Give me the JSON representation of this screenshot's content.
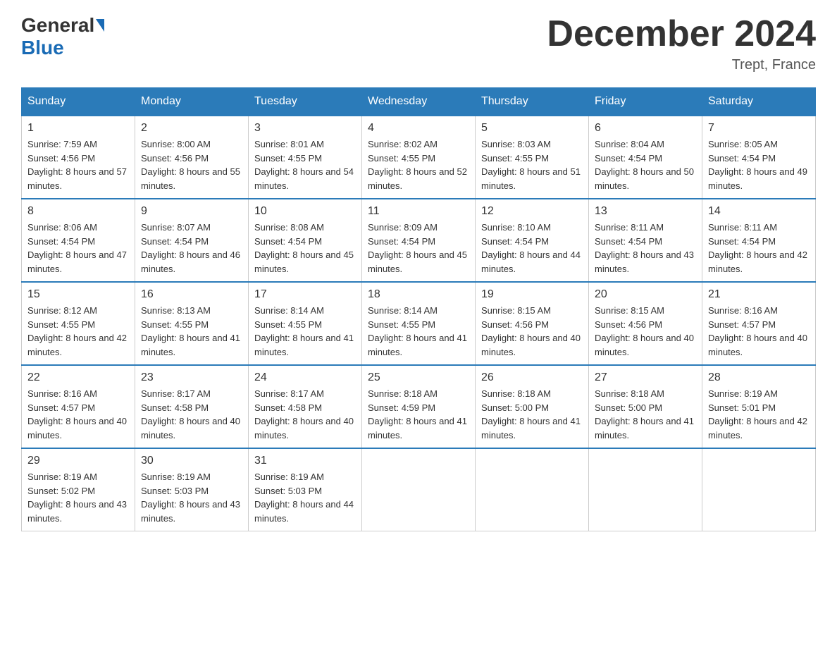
{
  "header": {
    "logo_general": "General",
    "logo_blue": "Blue",
    "month_title": "December 2024",
    "location": "Trept, France"
  },
  "days_of_week": [
    "Sunday",
    "Monday",
    "Tuesday",
    "Wednesday",
    "Thursday",
    "Friday",
    "Saturday"
  ],
  "weeks": [
    [
      {
        "day": "1",
        "sunrise": "7:59 AM",
        "sunset": "4:56 PM",
        "daylight": "8 hours and 57 minutes."
      },
      {
        "day": "2",
        "sunrise": "8:00 AM",
        "sunset": "4:56 PM",
        "daylight": "8 hours and 55 minutes."
      },
      {
        "day": "3",
        "sunrise": "8:01 AM",
        "sunset": "4:55 PM",
        "daylight": "8 hours and 54 minutes."
      },
      {
        "day": "4",
        "sunrise": "8:02 AM",
        "sunset": "4:55 PM",
        "daylight": "8 hours and 52 minutes."
      },
      {
        "day": "5",
        "sunrise": "8:03 AM",
        "sunset": "4:55 PM",
        "daylight": "8 hours and 51 minutes."
      },
      {
        "day": "6",
        "sunrise": "8:04 AM",
        "sunset": "4:54 PM",
        "daylight": "8 hours and 50 minutes."
      },
      {
        "day": "7",
        "sunrise": "8:05 AM",
        "sunset": "4:54 PM",
        "daylight": "8 hours and 49 minutes."
      }
    ],
    [
      {
        "day": "8",
        "sunrise": "8:06 AM",
        "sunset": "4:54 PM",
        "daylight": "8 hours and 47 minutes."
      },
      {
        "day": "9",
        "sunrise": "8:07 AM",
        "sunset": "4:54 PM",
        "daylight": "8 hours and 46 minutes."
      },
      {
        "day": "10",
        "sunrise": "8:08 AM",
        "sunset": "4:54 PM",
        "daylight": "8 hours and 45 minutes."
      },
      {
        "day": "11",
        "sunrise": "8:09 AM",
        "sunset": "4:54 PM",
        "daylight": "8 hours and 45 minutes."
      },
      {
        "day": "12",
        "sunrise": "8:10 AM",
        "sunset": "4:54 PM",
        "daylight": "8 hours and 44 minutes."
      },
      {
        "day": "13",
        "sunrise": "8:11 AM",
        "sunset": "4:54 PM",
        "daylight": "8 hours and 43 minutes."
      },
      {
        "day": "14",
        "sunrise": "8:11 AM",
        "sunset": "4:54 PM",
        "daylight": "8 hours and 42 minutes."
      }
    ],
    [
      {
        "day": "15",
        "sunrise": "8:12 AM",
        "sunset": "4:55 PM",
        "daylight": "8 hours and 42 minutes."
      },
      {
        "day": "16",
        "sunrise": "8:13 AM",
        "sunset": "4:55 PM",
        "daylight": "8 hours and 41 minutes."
      },
      {
        "day": "17",
        "sunrise": "8:14 AM",
        "sunset": "4:55 PM",
        "daylight": "8 hours and 41 minutes."
      },
      {
        "day": "18",
        "sunrise": "8:14 AM",
        "sunset": "4:55 PM",
        "daylight": "8 hours and 41 minutes."
      },
      {
        "day": "19",
        "sunrise": "8:15 AM",
        "sunset": "4:56 PM",
        "daylight": "8 hours and 40 minutes."
      },
      {
        "day": "20",
        "sunrise": "8:15 AM",
        "sunset": "4:56 PM",
        "daylight": "8 hours and 40 minutes."
      },
      {
        "day": "21",
        "sunrise": "8:16 AM",
        "sunset": "4:57 PM",
        "daylight": "8 hours and 40 minutes."
      }
    ],
    [
      {
        "day": "22",
        "sunrise": "8:16 AM",
        "sunset": "4:57 PM",
        "daylight": "8 hours and 40 minutes."
      },
      {
        "day": "23",
        "sunrise": "8:17 AM",
        "sunset": "4:58 PM",
        "daylight": "8 hours and 40 minutes."
      },
      {
        "day": "24",
        "sunrise": "8:17 AM",
        "sunset": "4:58 PM",
        "daylight": "8 hours and 40 minutes."
      },
      {
        "day": "25",
        "sunrise": "8:18 AM",
        "sunset": "4:59 PM",
        "daylight": "8 hours and 41 minutes."
      },
      {
        "day": "26",
        "sunrise": "8:18 AM",
        "sunset": "5:00 PM",
        "daylight": "8 hours and 41 minutes."
      },
      {
        "day": "27",
        "sunrise": "8:18 AM",
        "sunset": "5:00 PM",
        "daylight": "8 hours and 41 minutes."
      },
      {
        "day": "28",
        "sunrise": "8:19 AM",
        "sunset": "5:01 PM",
        "daylight": "8 hours and 42 minutes."
      }
    ],
    [
      {
        "day": "29",
        "sunrise": "8:19 AM",
        "sunset": "5:02 PM",
        "daylight": "8 hours and 43 minutes."
      },
      {
        "day": "30",
        "sunrise": "8:19 AM",
        "sunset": "5:03 PM",
        "daylight": "8 hours and 43 minutes."
      },
      {
        "day": "31",
        "sunrise": "8:19 AM",
        "sunset": "5:03 PM",
        "daylight": "8 hours and 44 minutes."
      },
      null,
      null,
      null,
      null
    ]
  ]
}
